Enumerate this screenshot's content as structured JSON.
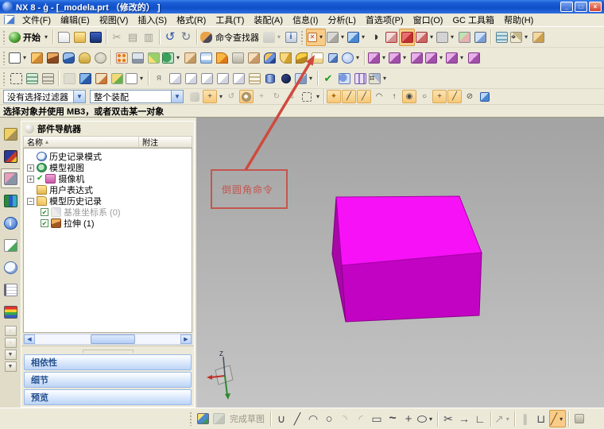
{
  "window": {
    "title": "NX 8 - ģ - [_modela.prt （修改的） ]"
  },
  "menu": {
    "items": [
      "文件(F)",
      "编辑(E)",
      "视图(V)",
      "插入(S)",
      "格式(R)",
      "工具(T)",
      "装配(A)",
      "信息(I)",
      "分析(L)",
      "首选项(P)",
      "窗口(O)",
      "GC 工具箱",
      "帮助(H)"
    ]
  },
  "toolbar": {
    "start": "开始",
    "command_finder": "命令查找器"
  },
  "selection_bar": {
    "filter": "没有选择过滤器",
    "scope": "整个装配"
  },
  "prompt": {
    "text": "选择对象并使用 MB3，或者双击某一对象"
  },
  "part_navigator": {
    "title": "部件导航器",
    "columns": {
      "name": "名称",
      "note": "附注"
    },
    "tree": [
      {
        "label": "历史记录模式"
      },
      {
        "label": "模型视图"
      },
      {
        "label": "摄像机"
      },
      {
        "label": "用户表达式"
      },
      {
        "label": "模型历史记录"
      },
      {
        "label": "基准坐标系 (0)"
      },
      {
        "label": "拉伸 (1)"
      }
    ],
    "panels": [
      "相依性",
      "细节",
      "预览"
    ]
  },
  "annotation": {
    "text": "倒圆角命令"
  },
  "sketch_toolbar": {
    "finish": "完成草图"
  },
  "triad": {
    "z": "Z"
  },
  "icons": {
    "dropdown": "▾",
    "undo": "↺",
    "redo": "↻",
    "cut": "✂",
    "copy": "▤",
    "paste": "▥",
    "check": "✔",
    "plus": "+",
    "minus": "−",
    "sort": "▴",
    "minimize": "_",
    "maximize": "□",
    "close": "×",
    "left": "◀",
    "right": "▶",
    "down": "▼",
    "dot": "·",
    "line": "╱",
    "arc": "◠",
    "circle": "○",
    "rect": "▭",
    "profile": "∪",
    "spline": "~",
    "point": "+",
    "corner1": "◝",
    "corner2": "◜",
    "trim": "✂",
    "extend": "→",
    "mkcorner": "∟",
    "dim": "↗",
    "parallel": "∥",
    "constr": "⊔",
    "snap_up": "↑",
    "center": "◉",
    "quadrant": "○",
    "intersect": "+",
    "existing": "╱",
    "tangent": "⊘",
    "render_style": "◑",
    "info": "i"
  },
  "colors": {
    "annotation_red": "#c4564e",
    "model_top": "#f711f7",
    "model_front": "#c303c3",
    "model_left": "#a708a7",
    "titlebar_blue": "#0f4fc8",
    "highlight_orange": "#f8cd8a"
  }
}
